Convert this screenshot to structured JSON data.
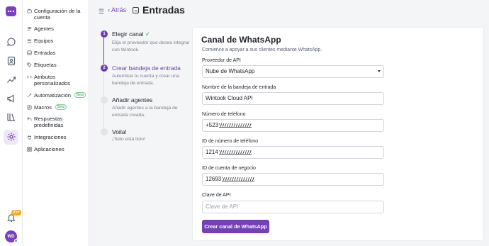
{
  "rail": {
    "icons": [
      "logo-icon",
      "chat-icon",
      "contacts-icon",
      "reports-icon",
      "campaigns-icon",
      "library-icon",
      "settings-icon",
      "bell-icon"
    ],
    "notification_badge": "99+",
    "avatar_initials": "WD",
    "accent": "#7b3fc4"
  },
  "menu": {
    "items": [
      {
        "label": "Configuración de la cuenta",
        "icon": "briefcase-icon"
      },
      {
        "label": "Agentes",
        "icon": "people-icon"
      },
      {
        "label": "Equipos",
        "icon": "team-icon"
      },
      {
        "label": "Entradas",
        "icon": "inbox-icon"
      },
      {
        "label": "Etiquetas",
        "icon": "tag-icon"
      },
      {
        "label": "Atributos personalizados",
        "icon": "code-icon"
      },
      {
        "label": "Automatización",
        "icon": "automation-icon",
        "badge": "Beta"
      },
      {
        "label": "Macros",
        "icon": "macro-icon",
        "badge": "Beta"
      },
      {
        "label": "Respuestas predefinidas",
        "icon": "reply-icon"
      },
      {
        "label": "Integraciones",
        "icon": "plug-icon"
      },
      {
        "label": "Aplicaciones",
        "icon": "apps-icon"
      }
    ]
  },
  "header": {
    "back_label": "Atrás",
    "title": "Entradas"
  },
  "steps": [
    {
      "number": "1",
      "title": "Elegir canal",
      "check": "✓",
      "description": "Elija el proveedor que desea integrar con Wintook.",
      "state": "done"
    },
    {
      "number": "2",
      "title": "Crear bandeja de entrada",
      "description": "Autenticar tu cuenta y crear una bandeja de entrada.",
      "state": "active"
    },
    {
      "number": "3",
      "title": "Añadir agentes",
      "description": "Añadir agentes a la bandeja de entrada creada.",
      "state": "pending"
    },
    {
      "number": "4",
      "title": "Voila!",
      "description": "¡Todo está listo!",
      "state": "pending"
    }
  ],
  "form": {
    "title": "Canal de WhatsApp",
    "subtitle": "Comience a apoyar a sus clientes mediante WhatsApp.",
    "provider_label": "Proveedor de API",
    "provider_value": "Nube de WhatsApp",
    "inbox_name_label": "Nombre de la bandeja de entrada",
    "inbox_name_value": "Wintook Cloud API",
    "phone_label": "Número de teléfono",
    "phone_value_visible": "+523",
    "phone_id_label": "ID de número de teléfono",
    "phone_id_value_visible": "1214",
    "business_id_label": "ID de cuenta de negocio",
    "business_id_value_visible": "12693",
    "api_key_label": "Clave de API",
    "api_key_placeholder": "Clave de API",
    "submit_label": "Crear canal de WhatsApp",
    "button_color": "#7340b5"
  }
}
